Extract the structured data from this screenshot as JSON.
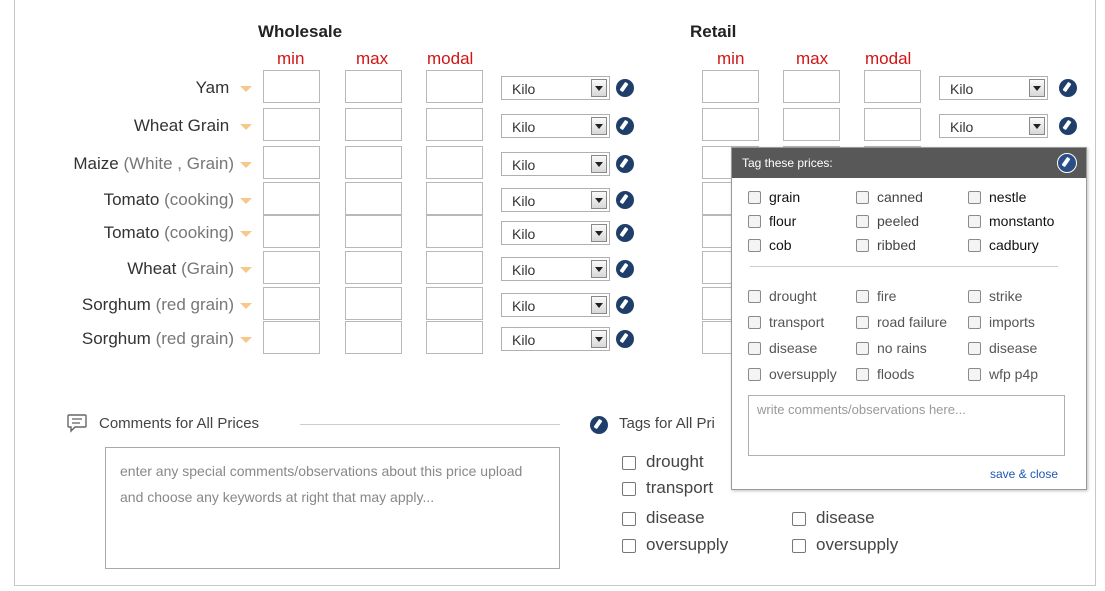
{
  "wholesale": {
    "title": "Wholesale",
    "cols": [
      "min",
      "max",
      "modal"
    ]
  },
  "retail": {
    "title": "Retail",
    "cols": [
      "min",
      "max",
      "modal"
    ]
  },
  "rows": [
    {
      "name": "Yam",
      "qualifier": ""
    },
    {
      "name": "Wheat Grain",
      "qualifier": ""
    },
    {
      "name": "Maize",
      "qualifier": "(White , Grain)"
    },
    {
      "name": "Tomato",
      "qualifier": "(cooking)"
    },
    {
      "name": "Tomato",
      "qualifier": "(cooking)"
    },
    {
      "name": "Wheat",
      "qualifier": "(Grain)"
    },
    {
      "name": "Sorghum",
      "qualifier": "(red grain)"
    },
    {
      "name": "Sorghum",
      "qualifier": "(red grain)"
    }
  ],
  "unit_value": "Kilo",
  "popup": {
    "title": "Tag these prices:",
    "group1": [
      [
        "grain",
        "canned",
        "nestle"
      ],
      [
        "flour",
        "peeled",
        "monstanto"
      ],
      [
        "cob",
        "ribbed",
        "cadbury"
      ]
    ],
    "group2": [
      [
        "drought",
        "fire",
        "strike"
      ],
      [
        "transport",
        "road failure",
        "imports"
      ],
      [
        "disease",
        "no rains",
        "disease"
      ],
      [
        "oversupply",
        "floods",
        "wfp p4p"
      ]
    ],
    "comment_placeholder": "write comments/observations here...",
    "save_label": "save & close"
  },
  "comments": {
    "title": "Comments for All Prices",
    "placeholder": "enter any special comments/observations about this price upload and choose any keywords at right that may apply..."
  },
  "tags_all": {
    "title": "Tags for All Pri",
    "left": [
      "drought",
      "transport",
      "disease",
      "oversupply"
    ],
    "right": [
      "disease",
      "oversupply"
    ]
  }
}
